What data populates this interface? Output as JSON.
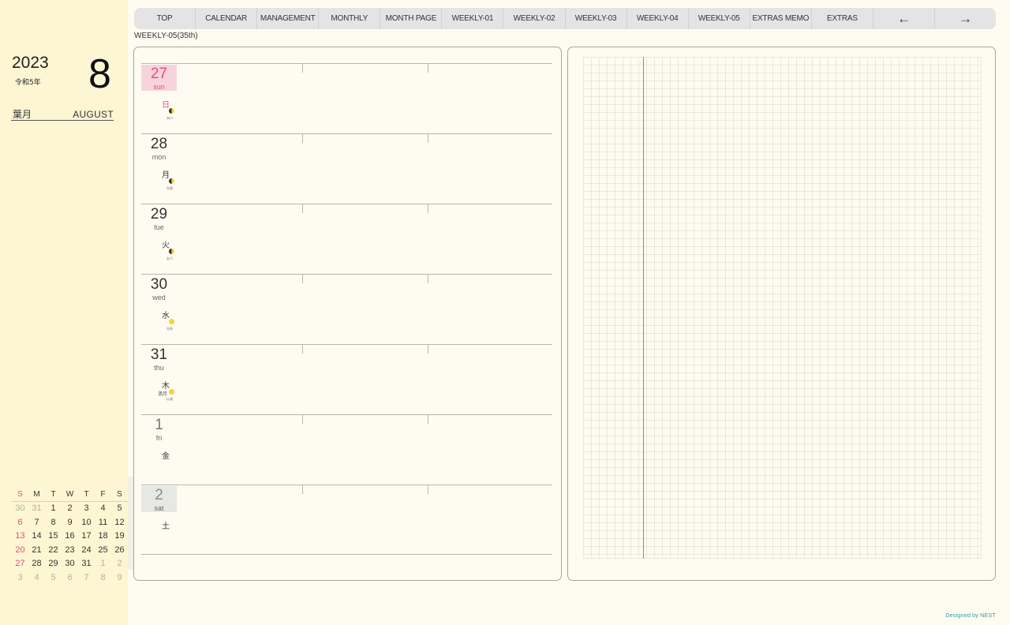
{
  "sidebar": {
    "year": "2023",
    "era": "令和5年",
    "month_number": "8",
    "month_jp": "葉月",
    "month_en": "AUGUST"
  },
  "nav": {
    "items": [
      "TOP",
      "CALENDAR",
      "MANAGEMENT",
      "MONTHLY",
      "MONTH PAGE",
      "WEEKLY-01",
      "WEEKLY-02",
      "WEEKLY-03",
      "WEEKLY-04",
      "WEEKLY-05",
      "EXTRAS MEMO",
      "EXTRAS"
    ],
    "prev_arrow": "←",
    "next_arrow": "→"
  },
  "page_label": "WEEKLY-05(35th)",
  "days": [
    {
      "num": "27",
      "dow": "sun",
      "kanji": "日",
      "type": "sun",
      "moon": "half",
      "rokuyo": "赤口",
      "note": ""
    },
    {
      "num": "28",
      "dow": "mon",
      "kanji": "月",
      "type": "weekday",
      "moon": "half",
      "rokuyo": "先勝",
      "note": ""
    },
    {
      "num": "29",
      "dow": "tue",
      "kanji": "火",
      "type": "weekday",
      "moon": "half",
      "rokuyo": "友引",
      "note": ""
    },
    {
      "num": "30",
      "dow": "wed",
      "kanji": "水",
      "type": "weekday",
      "moon": "full",
      "rokuyo": "先負",
      "note": ""
    },
    {
      "num": "31",
      "dow": "thu",
      "kanji": "木",
      "type": "weekday",
      "moon": "full",
      "rokuyo": "仏滅",
      "note": "満月"
    },
    {
      "num": "1",
      "dow": "fri",
      "kanji": "金",
      "type": "light",
      "moon": "",
      "rokuyo": "",
      "note": ""
    },
    {
      "num": "2",
      "dow": "sat",
      "kanji": "土",
      "type": "sat",
      "moon": "",
      "rokuyo": "",
      "note": ""
    }
  ],
  "mini_calendar": {
    "headers": [
      "S",
      "M",
      "T",
      "W",
      "T",
      "F",
      "S"
    ],
    "weeks": [
      [
        "30",
        "31",
        "1",
        "2",
        "3",
        "4",
        "5"
      ],
      [
        "6",
        "7",
        "8",
        "9",
        "10",
        "11",
        "12"
      ],
      [
        "13",
        "14",
        "15",
        "16",
        "17",
        "18",
        "19"
      ],
      [
        "20",
        "21",
        "22",
        "23",
        "24",
        "25",
        "26"
      ],
      [
        "27",
        "28",
        "29",
        "30",
        "31",
        "1",
        "2"
      ],
      [
        "3",
        "4",
        "5",
        "6",
        "7",
        "8",
        "9"
      ]
    ],
    "dim_cells": [
      [
        0,
        0
      ],
      [
        0,
        1
      ],
      [
        4,
        5
      ],
      [
        4,
        6
      ],
      [
        5,
        0
      ],
      [
        5,
        1
      ],
      [
        5,
        2
      ],
      [
        5,
        3
      ],
      [
        5,
        4
      ],
      [
        5,
        5
      ],
      [
        5,
        6
      ]
    ]
  },
  "credit": "Designed by NEST",
  "colors": {
    "background": "#fefcf1",
    "sidebar": "#fdf6d3",
    "sunday": "#e0527a",
    "accent_credit": "#3aa0a7"
  }
}
